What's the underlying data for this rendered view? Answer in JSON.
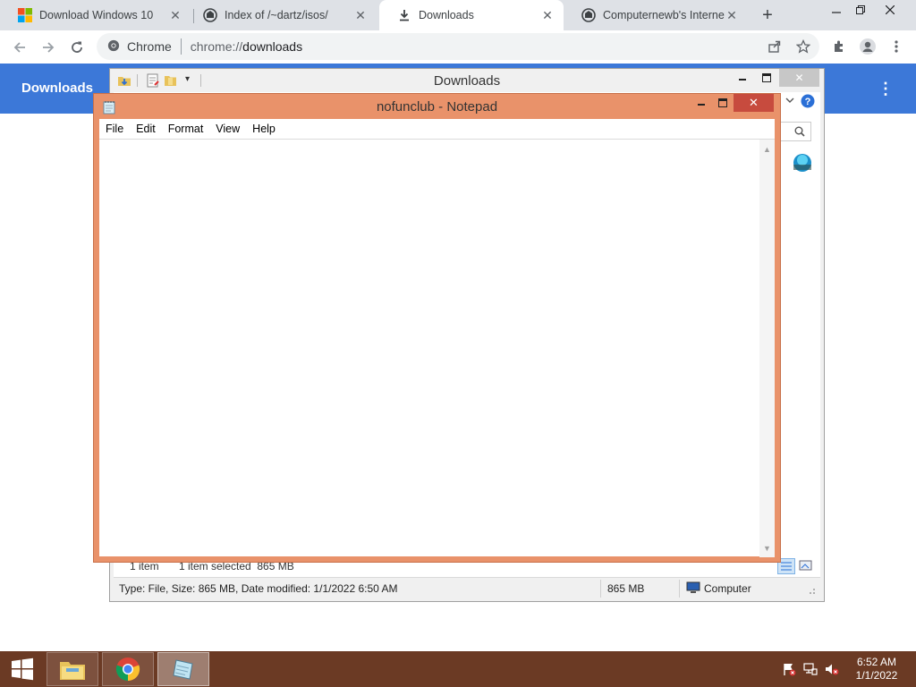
{
  "browser": {
    "tabs": [
      {
        "title": "Download Windows 10",
        "icon": "windows-logo-icon",
        "active": false
      },
      {
        "title": "Index of /~dartz/isos/",
        "icon": "site-favicon-icon",
        "active": false
      },
      {
        "title": "Downloads",
        "icon": "download-icon",
        "active": true
      },
      {
        "title": "Computernewb's Internet M",
        "icon": "site-favicon-icon",
        "active": false
      }
    ],
    "omnibox": {
      "chip": "Chrome",
      "scheme": "chrome://",
      "host": "downloads"
    },
    "colors": {
      "tabstrip": "#dee1e6",
      "header": "#3c78d8"
    }
  },
  "downloads_page": {
    "title": "Downloads"
  },
  "explorer": {
    "title": "Downloads",
    "status": {
      "count": "1 item",
      "selected": "1 item selected  865 MB"
    },
    "details": {
      "info": "Type: File, Size: 865 MB, Date modified: 1/1/2022 6:50 AM",
      "size": "865 MB",
      "location": "Computer"
    }
  },
  "notepad": {
    "title": "nofunclub - Notepad",
    "menu": [
      "File",
      "Edit",
      "Format",
      "View",
      "Help"
    ],
    "content": "",
    "colors": {
      "frame": "#e9926a",
      "close": "#c74b3e"
    }
  },
  "taskbar": {
    "apps": [
      {
        "name": "File Explorer",
        "icon": "file-explorer-icon"
      },
      {
        "name": "Google Chrome",
        "icon": "chrome-icon"
      },
      {
        "name": "Notepad",
        "icon": "notepad-icon"
      }
    ],
    "clock": {
      "time": "6:52 AM",
      "date": "1/1/2022"
    }
  }
}
